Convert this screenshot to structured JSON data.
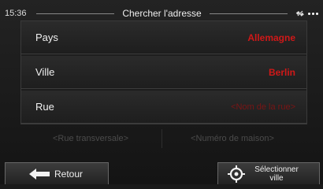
{
  "status_bar": {
    "time": "15:36",
    "title": "Chercher l'adresse",
    "icons": [
      "satellite-icon",
      "signal-dots-icon"
    ]
  },
  "rows": [
    {
      "label": "Pays",
      "value": "Allemagne"
    },
    {
      "label": "Ville",
      "value": "Berlin"
    },
    {
      "label": "Rue",
      "value": "<Nom de la rue>"
    }
  ],
  "options": {
    "cross_street": "<Rue transversale>",
    "house_number": "<Numéro de maison>"
  },
  "buttons": {
    "back_label": "Retour",
    "select_label": "Sélectionner ville"
  },
  "colors": {
    "accent_red": "#d01818",
    "disabled_text": "#4b4b4b",
    "background": "#1a1a1a"
  }
}
